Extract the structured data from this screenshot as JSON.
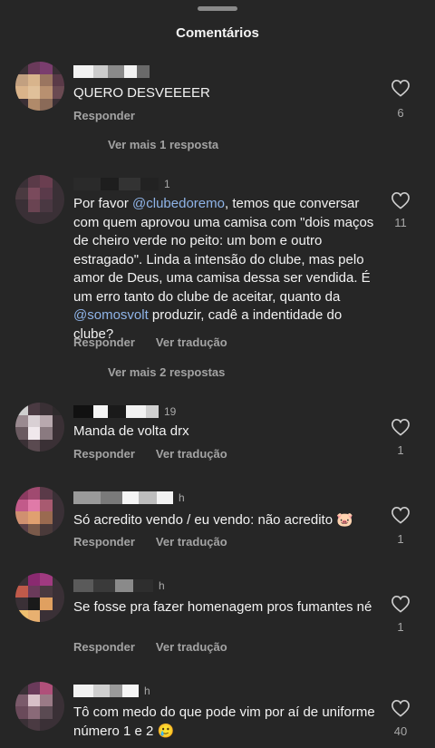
{
  "sheet": {
    "title": "Comentários"
  },
  "labels": {
    "reply": "Responder",
    "translate": "Ver tradução"
  },
  "comments": [
    {
      "text": "QUERO DESVEEEER",
      "likes": "6",
      "more_replies": "Ver mais 1 resposta",
      "avatar_colors": [
        "#3a2f35",
        "#6a3a5a",
        "#7a3d6e",
        "#3a2f35",
        "#c2a080",
        "#d8b48c",
        "#9a7560",
        "#5a3a48",
        "#d9b38a",
        "#e0c09a",
        "#b89070",
        "#6a4a52",
        "#3a2f35",
        "#b08a6a",
        "#8a6a58",
        "#3a2f35"
      ],
      "meta_blocks": [
        "#f2f2f2",
        "#cccccc",
        "#8a8a8a",
        "#f2f2f2",
        "#6a6a6a"
      ]
    },
    {
      "time": "1",
      "text_parts": [
        "Por favor ",
        "@clubedoremo",
        ", temos que conversar com quem aprovou uma camisa com \"dois maços de cheiro verde no peito: um bom e outro estragado\". Linda a intensão do clube, mas pelo amor de Deus, uma camisa dessa ser vendida. É um erro tanto do clube de aceitar, quanto da ",
        "@somosvolt",
        "  produzir, cadê a indentidade do clube?"
      ],
      "likes": "11",
      "more_replies": "Ver mais 2 respostas",
      "avatar_colors": [
        "#3a3036",
        "#5a3a48",
        "#6a3e50",
        "#3a3036",
        "#4a3a40",
        "#7a4a5c",
        "#5a3a4a",
        "#3a3036",
        "#3a3036",
        "#6a4452",
        "#4a3842",
        "#3a3036",
        "#3a3036",
        "#3a3036",
        "#3a3036",
        "#3a3036"
      ],
      "meta_blocks": [
        "#2a2a2a",
        "#1e1e1e",
        "#333333",
        "#222222"
      ]
    },
    {
      "time": "19",
      "text": "Manda de volta drx",
      "likes": "1",
      "avatar_colors": [
        "#cfcfcf",
        "#4a3a42",
        "#3a3035",
        "#2e2a2c",
        "#9a8a90",
        "#d9d0d4",
        "#b8a8ae",
        "#3a3035",
        "#6a5a60",
        "#f0e8ec",
        "#8a7a80",
        "#3a3035",
        "#3a3035",
        "#5a4a50",
        "#3a3035",
        "#3a3035"
      ],
      "meta_blocks": [
        "#111111",
        "#f5f5f5",
        "#1a1a1a",
        "#f2f2f2",
        "#d0d0d0"
      ]
    },
    {
      "time": "h",
      "text": "Só acredito vendo / eu vendo: não acredito 🐷",
      "likes": "1",
      "avatar_colors": [
        "#8a3a60",
        "#a04a70",
        "#5a3a48",
        "#3a3036",
        "#c25a8a",
        "#e07aa8",
        "#a85a70",
        "#3a3036",
        "#d09070",
        "#e0a070",
        "#9a6a50",
        "#3a3036",
        "#5a4048",
        "#7a5a4a",
        "#4a3a3a",
        "#3a3036"
      ],
      "meta_blocks": [
        "#9a9a9a",
        "#7a7a7a",
        "#f5f5f5",
        "#bdbdbd",
        "#f2f2f2"
      ]
    },
    {
      "time": "h",
      "text": "Se fosse pra fazer homenagem pros fumantes né",
      "likes": "1",
      "avatar_colors": [
        "#3a3036",
        "#8a2a70",
        "#a03a80",
        "#3a3036",
        "#c05a4a",
        "#6a3a5a",
        "#4a3a40",
        "#3a3036",
        "#3a3036",
        "#1a1a1a",
        "#e0a060",
        "#3a3036",
        "#f0c070",
        "#e8b070",
        "#3a3036",
        "#3a3036"
      ],
      "meta_blocks": [
        "#5a5a5a",
        "#3a3a3a",
        "#8a8a8a",
        "#2e2e2e"
      ]
    },
    {
      "time": "h",
      "text": "Tô com medo do que pode vim por aí de uniforme número 1 e 2 🥲",
      "likes": "40",
      "avatar_colors": [
        "#3a3036",
        "#6a3a5a",
        "#b0507a",
        "#3a3036",
        "#7a5a6a",
        "#d8c0c8",
        "#9a7a86",
        "#3a3036",
        "#6a4a5a",
        "#8a6a78",
        "#5a4a52",
        "#3a3036",
        "#3a3036",
        "#4a3a42",
        "#3a3036",
        "#3a3036"
      ],
      "meta_blocks": [
        "#f2f2f2",
        "#cfcfcf",
        "#9a9a9a",
        "#f5f5f5"
      ]
    }
  ]
}
